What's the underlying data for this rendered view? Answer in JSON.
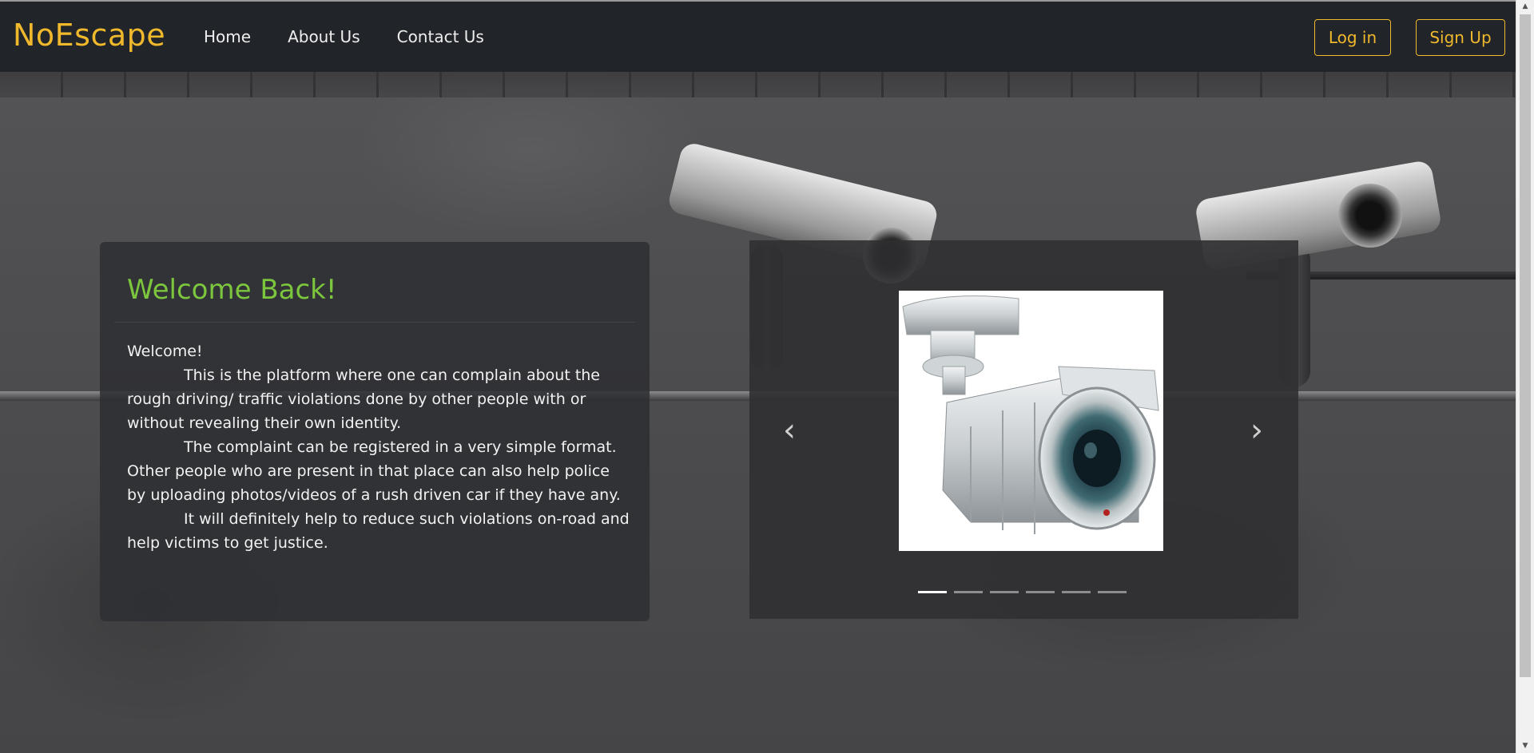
{
  "navbar": {
    "brand": "NoEscape",
    "links": [
      "Home",
      "About Us",
      "Contact Us"
    ],
    "login_label": "Log in",
    "signup_label": "Sign Up",
    "accent_color": "#f0b82c"
  },
  "welcome": {
    "title": "Welcome Back!",
    "greeting": "Welcome!",
    "paragraphs": [
      "This is the platform where one can complain about the rough driving/ traffic violations done by other people with or without revealing their own identity.",
      "The complaint can be registered in a very simple format. Other people who are present in that place can also help police by uploading photos/videos of a rush driven car if they have any.",
      "It will definitely help to reduce such violations on-road and help victims to get justice."
    ],
    "title_color": "#7cc63e"
  },
  "carousel": {
    "prev_icon": "chevron-left-icon",
    "next_icon": "chevron-right-icon",
    "slide_image": "cctv-camera-image",
    "indicator_count": 6,
    "active_index": 0
  }
}
